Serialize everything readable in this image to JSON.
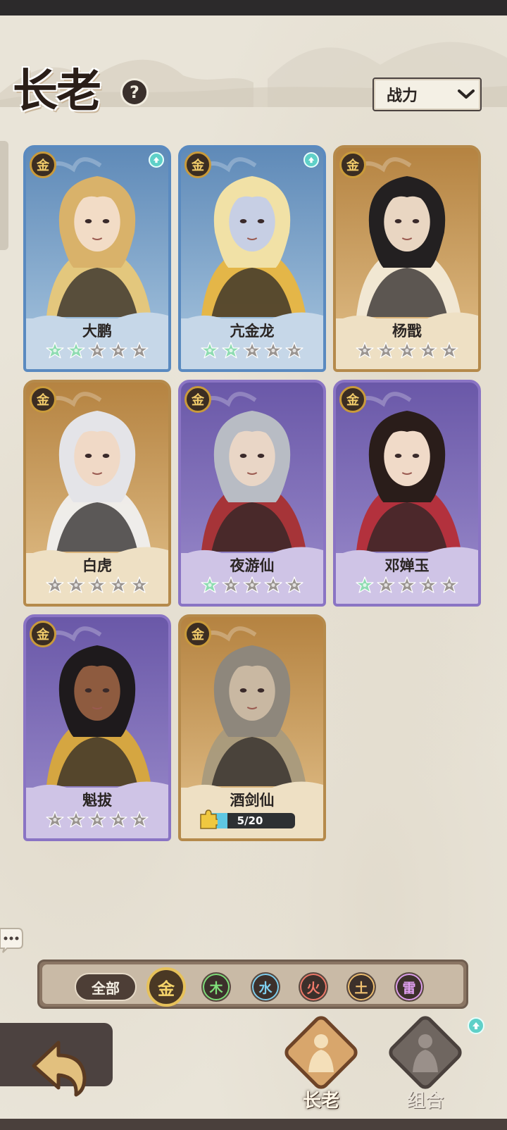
{
  "page": {
    "title": "长老",
    "help_glyph": "?"
  },
  "sort": {
    "label": "战力"
  },
  "element_badge_text": "金",
  "heroes": [
    {
      "name": "大鹏",
      "frame": "blue",
      "stars_lit": 2,
      "upgrade": true,
      "accent": "#e8c878",
      "hair": "#d9b26a",
      "skin": "#f2dcc6"
    },
    {
      "name": "亢金龙",
      "frame": "blue",
      "stars_lit": 2,
      "upgrade": true,
      "accent": "#e9b640",
      "hair": "#f1e1a6",
      "skin": "#c7cfe4"
    },
    {
      "name": "杨戬",
      "frame": "gold",
      "stars_lit": 0,
      "upgrade": false,
      "accent": "#f2ead8",
      "hair": "#232021",
      "skin": "#e9d6c2"
    },
    {
      "name": "白虎",
      "frame": "gold",
      "stars_lit": 0,
      "upgrade": false,
      "accent": "#f0f0f0",
      "hair": "#e4e4e8",
      "skin": "#f0d9c6"
    },
    {
      "name": "夜游仙",
      "frame": "purple",
      "stars_lit": 1,
      "upgrade": false,
      "accent": "#a83030",
      "hair": "#b8bcc4",
      "skin": "#e9d6c6"
    },
    {
      "name": "邓婵玉",
      "frame": "purple",
      "stars_lit": 1,
      "upgrade": false,
      "accent": "#b52d36",
      "hair": "#2a1d1a",
      "skin": "#f0dac8"
    },
    {
      "name": "魁拔",
      "frame": "purple",
      "stars_lit": 0,
      "upgrade": false,
      "accent": "#d9a93a",
      "hair": "#1e1a1c",
      "skin": "#8e5b3f"
    },
    {
      "name": "酒剑仙",
      "frame": "gold",
      "stars_lit": 0,
      "upgrade": false,
      "accent": "#a89a7d",
      "hair": "#8e877c",
      "skin": "#c9b8a2",
      "fragments": {
        "text": "5/20",
        "current": 5,
        "total": 20
      }
    }
  ],
  "filters": {
    "all_label": "全部",
    "elements": [
      {
        "label": "金",
        "color": "#f5d46a",
        "active": true
      },
      {
        "label": "木",
        "color": "#7fe07a",
        "active": false
      },
      {
        "label": "水",
        "color": "#7fd0f0",
        "active": false
      },
      {
        "label": "火",
        "color": "#f07a6a",
        "active": false
      },
      {
        "label": "土",
        "color": "#f0c070",
        "active": false
      },
      {
        "label": "雷",
        "color": "#e0a0f0",
        "active": false
      }
    ]
  },
  "nav": {
    "elders_label": "长老",
    "combo_label": "组合"
  },
  "icons": {
    "help": "question-mark-icon",
    "chevron": "chevron-down-icon",
    "star": "flower-star-icon",
    "upgrade": "up-arrow-icon",
    "fragment": "puzzle-piece-icon",
    "back": "back-arrow-icon",
    "chat": "chat-bubble-icon"
  },
  "colors": {
    "star_lit": "#8fdcb2",
    "star_unlit": "#9a9490"
  }
}
